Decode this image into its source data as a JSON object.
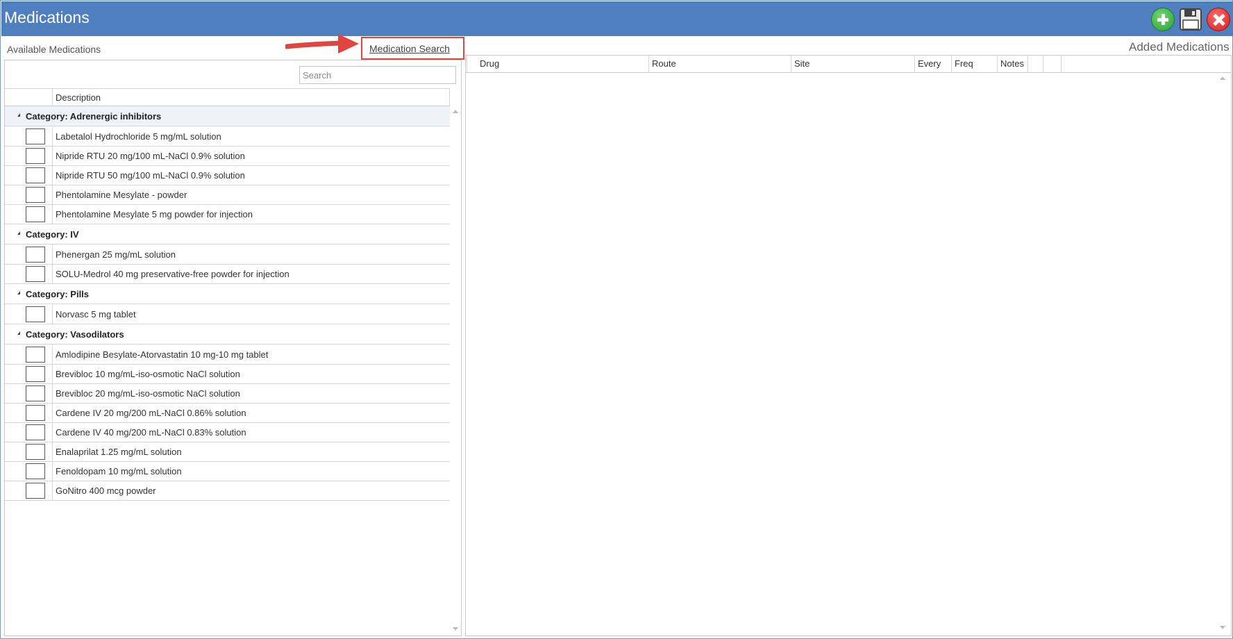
{
  "window": {
    "title": "Medications"
  },
  "toolbar": {
    "add_icon": "plus-circle-icon",
    "save_icon": "floppy-disk-icon",
    "close_icon": "close-x-icon"
  },
  "left": {
    "label": "Available Medications",
    "search_link": "Medication Search",
    "search_placeholder": "Search",
    "column_header": "Description",
    "categories": [
      {
        "label": "Category: Adrenergic inhibitors",
        "items": [
          "Labetalol Hydrochloride 5 mg/mL solution",
          "Nipride RTU 20 mg/100 mL-NaCl 0.9% solution",
          "Nipride RTU 50 mg/100 mL-NaCl 0.9% solution",
          "Phentolamine Mesylate - powder",
          "Phentolamine Mesylate 5 mg powder for injection"
        ]
      },
      {
        "label": "Category: IV",
        "items": [
          "Phenergan 25 mg/mL solution",
          "SOLU-Medrol 40 mg preservative-free powder for injection"
        ]
      },
      {
        "label": "Category: Pills",
        "items": [
          "Norvasc 5 mg tablet"
        ]
      },
      {
        "label": "Category: Vasodilators",
        "items": [
          "Amlodipine Besylate-Atorvastatin 10 mg-10 mg tablet",
          "Brevibloc 10 mg/mL-iso-osmotic NaCl solution",
          "Brevibloc 20 mg/mL-iso-osmotic NaCl solution",
          "Cardene IV 20 mg/200 mL-NaCl 0.86% solution",
          "Cardene IV 40 mg/200 mL-NaCl 0.83% solution",
          "Enalaprilat 1.25 mg/mL solution",
          "Fenoldopam 10 mg/mL solution",
          "GoNitro 400 mcg powder"
        ]
      }
    ]
  },
  "right": {
    "label": "Added Medications",
    "columns": [
      "Drug",
      "Route",
      "Site",
      "Every",
      "Freq",
      "Notes",
      "",
      "",
      ""
    ]
  }
}
